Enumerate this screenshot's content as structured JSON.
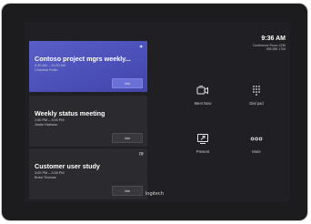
{
  "meetings": [
    {
      "title": "Contoso project mgrs weekly...",
      "time": "9:30 AM – 10:30 AM",
      "organizer": "Christina Rollin",
      "join_label": "Join",
      "corner_icon": "speaker-icon",
      "active": true
    },
    {
      "title": "Weekly status meeting",
      "time": "1:00 PM – 3:00 PM",
      "organizer": "Justin Harrison",
      "join_label": "Join",
      "corner_icon": "none",
      "active": false
    },
    {
      "title": "Customer user study",
      "time": "3:00 PM – 3:35 PM",
      "organizer": "Brian Thomas",
      "join_label": "Join",
      "corner_icon": "share-icon",
      "active": false
    }
  ],
  "status": {
    "clock": "9:36 AM",
    "room": "Conference Room 1296",
    "phone": "555-555-1706"
  },
  "actions": {
    "meet_now": "Meet Now",
    "dial_pad": "Dial pad",
    "present": "Present",
    "more": "More"
  },
  "brand": "logitech",
  "colors": {
    "active_card": "#5a5fc8",
    "screen_bg": "#202024",
    "bezel": "#1c1c1e"
  }
}
